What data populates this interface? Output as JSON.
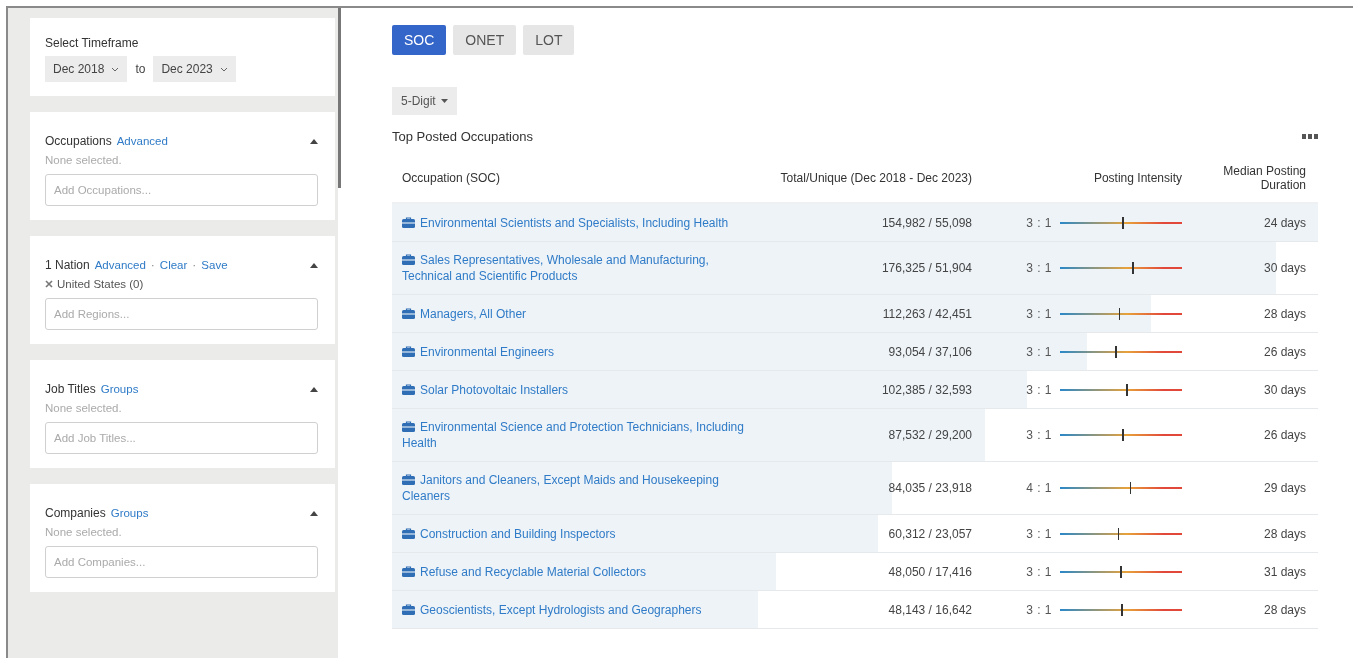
{
  "sidebar": {
    "timeframe": {
      "label": "Select Timeframe",
      "from": "Dec 2018",
      "joiner": "to",
      "to": "Dec 2023"
    },
    "link_separator": "·",
    "sections": [
      {
        "title": "Occupations",
        "links": [
          "Advanced"
        ],
        "summary": "None selected.",
        "placeholder": "Add Occupations..."
      },
      {
        "title": "1 Nation",
        "links": [
          "Advanced",
          "Clear",
          "Save"
        ],
        "selections": [
          "United States (0)"
        ],
        "placeholder": "Add Regions..."
      },
      {
        "title": "Job Titles",
        "links": [
          "Groups"
        ],
        "summary": "None selected.",
        "placeholder": "Add Job Titles..."
      },
      {
        "title": "Companies",
        "links": [
          "Groups"
        ],
        "summary": "None selected.",
        "placeholder": "Add Companies..."
      }
    ]
  },
  "tabs": [
    {
      "label": "SOC",
      "selected": true
    },
    {
      "label": "ONET",
      "selected": false
    },
    {
      "label": "LOT",
      "selected": false
    }
  ],
  "level_dropdown": "5-Digit",
  "table": {
    "title": "Top Posted Occupations",
    "columns": [
      "Occupation (SOC)",
      "Total/Unique (Dec 2018 - Dec 2023)",
      "Posting Intensity",
      "Median Posting Duration"
    ],
    "rows": [
      {
        "occupation": "Environmental Scientists and Specialists, Including Health",
        "totals": "154,982 / 55,098",
        "level": 1.0,
        "ratio": "3 : 1",
        "intensity": {
          "level": 0.52
        },
        "duration": "24 days"
      },
      {
        "occupation": "Sales Representatives, Wholesale and Manufacturing, Technical and Scientific Products",
        "totals": "176,325 / 51,904",
        "level": 0.955,
        "ratio": "3 : 1",
        "intensity": {
          "level": 0.6
        },
        "duration": "30 days"
      },
      {
        "occupation": "Managers, All Other",
        "totals": "112,263 / 42,451",
        "level": 0.82,
        "ratio": "3 : 1",
        "intensity": {
          "level": 0.49
        },
        "duration": "28 days"
      },
      {
        "occupation": "Environmental Engineers",
        "totals": "93,054 / 37,106",
        "level": 0.75,
        "ratio": "3 : 1",
        "intensity": {
          "level": 0.46
        },
        "duration": "26 days"
      },
      {
        "occupation": "Solar Photovoltaic Installers",
        "totals": "102,385 / 32,593",
        "level": 0.686,
        "ratio": "3 : 1",
        "intensity": {
          "level": 0.55
        },
        "duration": "30 days"
      },
      {
        "occupation": "Environmental Science and Protection Technicians, Including Health",
        "totals": "87,532 / 29,200",
        "level": 0.64,
        "ratio": "3 : 1",
        "intensity": {
          "level": 0.52
        },
        "duration": "26 days"
      },
      {
        "occupation": "Janitors and Cleaners, Except Maids and Housekeeping Cleaners",
        "totals": "84,035 / 23,918",
        "level": 0.54,
        "ratio": "4 : 1",
        "intensity": {
          "level": 0.58
        },
        "duration": "29 days"
      },
      {
        "occupation": "Construction and Building Inspectors",
        "totals": "60,312 / 23,057",
        "level": 0.525,
        "ratio": "3 : 1",
        "intensity": {
          "level": 0.48
        },
        "duration": "28 days"
      },
      {
        "occupation": "Refuse and Recyclable Material Collectors",
        "totals": "48,050 / 17,416",
        "level": 0.415,
        "ratio": "3 : 1",
        "intensity": {
          "level": 0.5
        },
        "duration": "31 days"
      },
      {
        "occupation": "Geoscientists, Except Hydrologists and Geographers",
        "totals": "48,143 / 16,642",
        "level": 0.395,
        "ratio": "3 : 1",
        "intensity": {
          "level": 0.51
        },
        "duration": "28 days"
      }
    ]
  }
}
